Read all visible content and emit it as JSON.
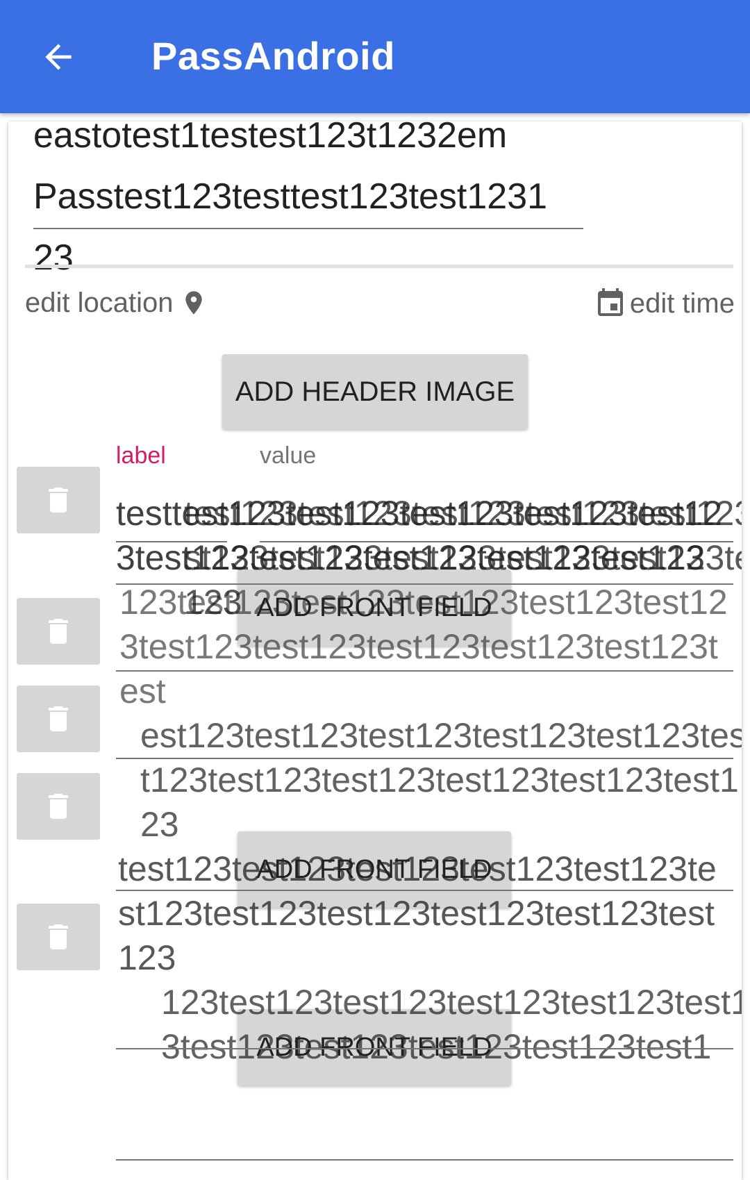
{
  "appbar": {
    "title": "PassAndroid",
    "back_icon": "arrow-back-icon",
    "color": "#3b6fe4"
  },
  "description": {
    "clipped_line": "eastotest1testest123t1232em",
    "lines": [
      "Passtest123testtest123test1231",
      "23"
    ]
  },
  "edit_location": {
    "label": "edit location",
    "icon": "location-pin-icon"
  },
  "edit_time": {
    "label": "edit time",
    "icon": "calendar-icon"
  },
  "add_header_image": {
    "label": "ADD HEADER IMAGE"
  },
  "field_headers": {
    "label": "label",
    "value": "value",
    "label_color": "#d81b60"
  },
  "add_front_field": {
    "label": "ADD FRONT FIELD"
  },
  "fields_text": {
    "a": "testtest123test123test123test123test123test123test123test123test123test123",
    "b": "test123test123test123test123test123test123test123test123test123test123test123",
    "c": "123test123test123test123test123test123test123test123test123test123test123test",
    "d": "est123test123test123test123test123test123test123test123test123test123test123",
    "e": "test123test123test123test123test123test123test123test123test123test123test123",
    "f": "123test123test123test123test123test123test123test123test123test123test1"
  }
}
